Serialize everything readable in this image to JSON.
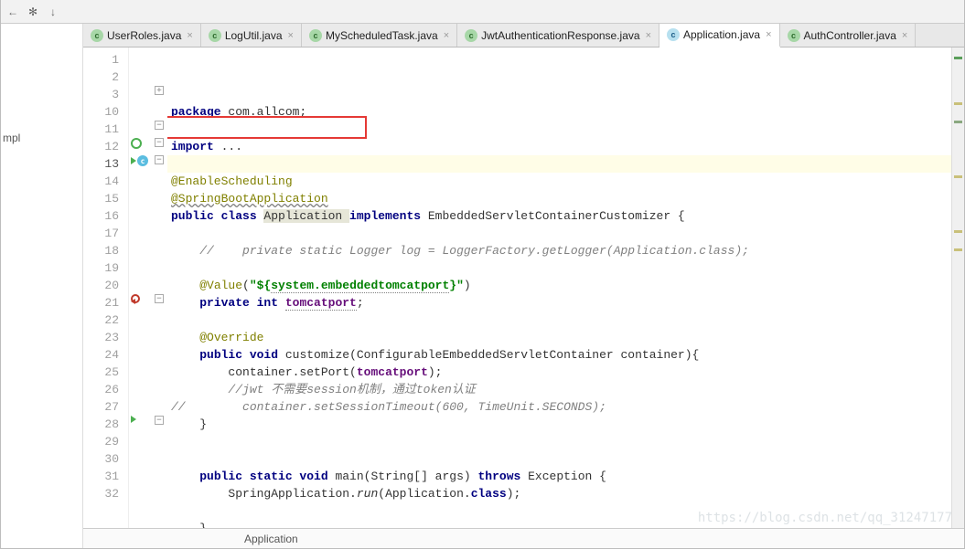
{
  "toolbar": {
    "icons": [
      "back",
      "gear",
      "apply"
    ]
  },
  "tabs": [
    {
      "label": "UserRoles.java",
      "active": false
    },
    {
      "label": "LogUtil.java",
      "active": false
    },
    {
      "label": "MyScheduledTask.java",
      "active": false
    },
    {
      "label": "JwtAuthenticationResponse.java",
      "active": false
    },
    {
      "label": "Application.java",
      "active": true
    },
    {
      "label": "AuthController.java",
      "active": false
    }
  ],
  "sidebar": {
    "truncated_label": "mpl"
  },
  "line_numbers": [
    "1",
    "2",
    "3",
    "10",
    "11",
    "12",
    "13",
    "14",
    "15",
    "16",
    "17",
    "18",
    "19",
    "20",
    "21",
    "22",
    "23",
    "24",
    "25",
    "26",
    "27",
    "28",
    "29",
    "30",
    "31",
    "32"
  ],
  "current_line_index": 6,
  "code": {
    "l1": {
      "a": "package ",
      "b": "com.allcom;"
    },
    "l3": {
      "a": "import ",
      "b": "..."
    },
    "l11": "@EnableScheduling",
    "l12": "@SpringBootApplication",
    "l13": {
      "a": "public class ",
      "b": "Application ",
      "c": "implements ",
      "d": "EmbeddedServletContainerCustomizer {"
    },
    "l15": "//    private static Logger log = LoggerFactory.getLogger(Application.class);",
    "l17": {
      "a": "@Value",
      "b": "(",
      "c": "\"${",
      "d": "system.embeddedtomcatport",
      "e": "}\"",
      "f": ")"
    },
    "l18": {
      "a": "private int ",
      "b": "tomcatport",
      "c": ";"
    },
    "l20": "@Override",
    "l21": {
      "a": "public void ",
      "b": "customize",
      "c": "(ConfigurableEmbeddedServletContainer container){"
    },
    "l22": {
      "a": "container.setPort(",
      "b": "tomcatport",
      "c": ");"
    },
    "l23": "//jwt 不需要session机制，通过token认证",
    "l24": {
      "a": "//",
      "b": "        container.setSessionTimeout(600, TimeUnit.SECONDS);"
    },
    "l25": "}",
    "l28": {
      "a": "public static void ",
      "b": "main",
      "c": "(String[] args) ",
      "d": "throws ",
      "e": "Exception {"
    },
    "l29": {
      "a": "SpringApplication.",
      "b": "run",
      "c": "(Application.",
      "d": "class",
      "e": ");"
    },
    "l31": "}",
    "l32": ""
  },
  "breadcrumb": "Application",
  "watermark": "https://blog.csdn.net/qq_31247177"
}
